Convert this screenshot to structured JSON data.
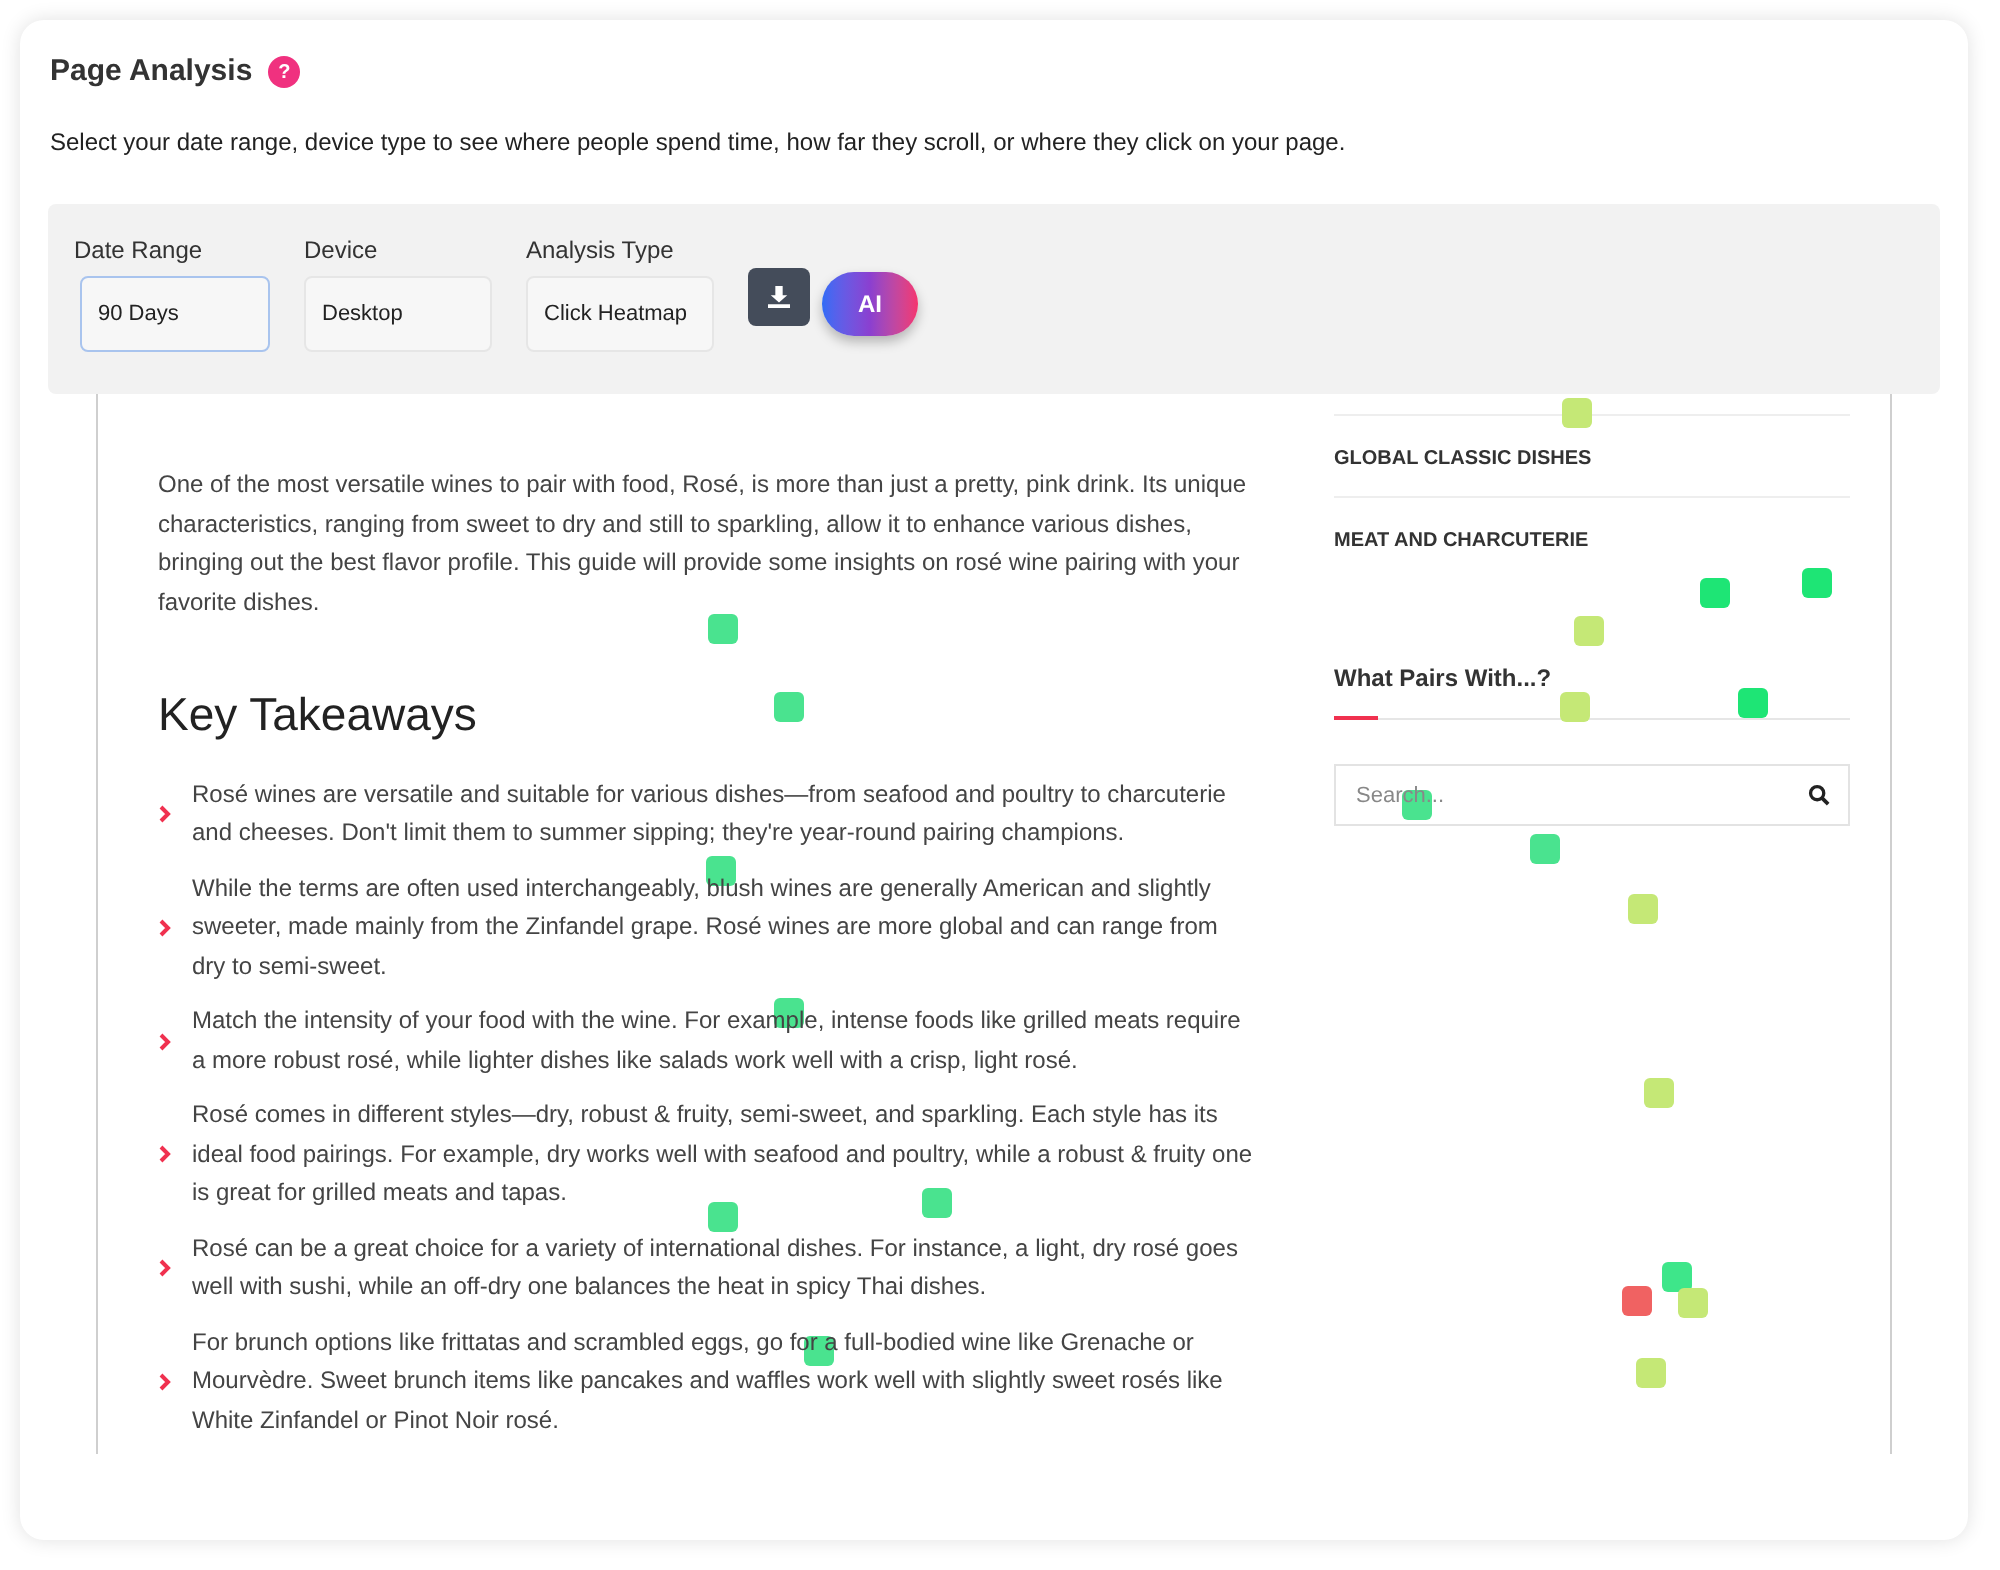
{
  "header": {
    "title": "Page Analysis",
    "help_icon": "?",
    "description": "Select your date range, device type to see where people spend time, how far they scroll, or where they click on your page."
  },
  "filters": [
    {
      "label": "Date Range",
      "value": "90 Days",
      "focused": true
    },
    {
      "label": "Device",
      "value": "Desktop",
      "focused": false
    },
    {
      "label": "Analysis Type",
      "value": "Click Heatmap",
      "focused": false
    }
  ],
  "ai_button": {
    "label": "AI"
  },
  "preview": {
    "intro": "One of the most versatile wines to pair with food, Rosé, is more than just a pretty, pink drink. Its unique characteristics, ranging from sweet to dry and still to sparkling, allow it to enhance various dishes, bringing out the best flavor profile. This guide will provide some insights on rosé wine pairing with your favorite dishes.",
    "heading": "Key Takeaways",
    "takeaways": [
      "Rosé wines are versatile and suitable for various dishes—from seafood and poultry to charcuterie and cheeses. Don't limit them to summer sipping; they're year-round pairing champions.",
      "While the terms are often used interchangeably, blush wines are generally American and slightly sweeter, made mainly from the Zinfandel grape. Rosé wines are more global and can range from dry to semi-sweet.",
      "Match the intensity of your food with the wine. For example, intense foods like grilled meats require a more robust rosé, while lighter dishes like salads work well with a crisp, light rosé.",
      "Rosé comes in different styles—dry, robust & fruity, semi-sweet, and sparkling. Each style has its ideal food pairings. For example, dry works well with seafood and poultry, while a robust & fruity one is great for grilled meats and tapas.",
      "Rosé can be a great choice for a variety of international dishes. For instance, a light, dry rosé goes well with sushi, while an off-dry one balances the heat in spicy Thai dishes.",
      "For brunch options like frittatas and scrambled eggs, go for a full-bodied wine like Grenache or Mourvèdre. Sweet brunch items like pancakes and waffles work well with slightly sweet rosés like White Zinfandel or Pinot Noir rosé."
    ],
    "sidebar_categories": [
      "GLOBAL CLASSIC DISHES",
      "MEAT AND CHARCUTERIE"
    ],
    "sidebar_heading": "What Pairs With...?",
    "search_placeholder": "Search..."
  },
  "click_dots": [
    {
      "color": "#c5e876"
    },
    {
      "color": "#4ae38f"
    },
    {
      "color": "#4ae38f"
    },
    {
      "color": "#1ee575"
    },
    {
      "color": "#1ee575"
    },
    {
      "color": "#c5e876"
    },
    {
      "color": "#c5e876"
    },
    {
      "color": "#1ee575"
    },
    {
      "color": "#4ae38f"
    },
    {
      "color": "#4ae38f"
    },
    {
      "color": "#c5e876"
    },
    {
      "color": "#4ae38f"
    },
    {
      "color": "#4ae38f"
    },
    {
      "color": "#c5e876"
    },
    {
      "color": "#4ae38f"
    },
    {
      "color": "#4ae38f"
    },
    {
      "color": "#3ee68a"
    },
    {
      "color": "#f06262"
    },
    {
      "color": "#c5e876"
    },
    {
      "color": "#4ae38f"
    },
    {
      "color": "#c5e876"
    }
  ]
}
